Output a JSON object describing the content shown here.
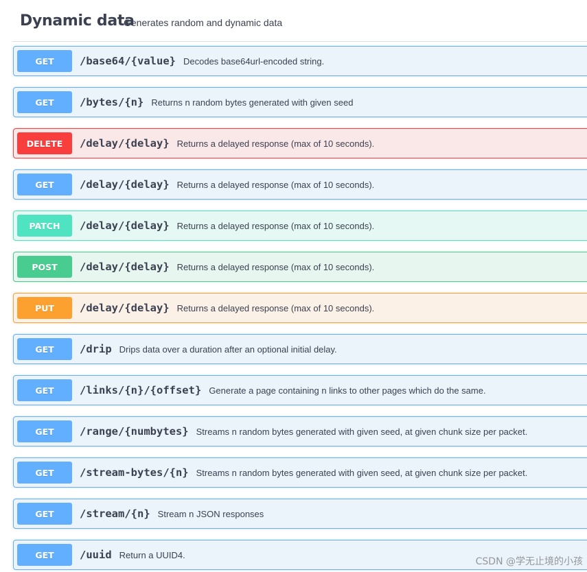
{
  "section": {
    "title": "Dynamic data",
    "description": "Generates random and dynamic data"
  },
  "operations": [
    {
      "method": "GET",
      "path": "/base64/{value}",
      "summary": "Decodes base64url-encoded string."
    },
    {
      "method": "GET",
      "path": "/bytes/{n}",
      "summary": "Returns n random bytes generated with given seed"
    },
    {
      "method": "DELETE",
      "path": "/delay/{delay}",
      "summary": "Returns a delayed response (max of 10 seconds)."
    },
    {
      "method": "GET",
      "path": "/delay/{delay}",
      "summary": "Returns a delayed response (max of 10 seconds)."
    },
    {
      "method": "PATCH",
      "path": "/delay/{delay}",
      "summary": "Returns a delayed response (max of 10 seconds)."
    },
    {
      "method": "POST",
      "path": "/delay/{delay}",
      "summary": "Returns a delayed response (max of 10 seconds)."
    },
    {
      "method": "PUT",
      "path": "/delay/{delay}",
      "summary": "Returns a delayed response (max of 10 seconds)."
    },
    {
      "method": "GET",
      "path": "/drip",
      "summary": "Drips data over a duration after an optional initial delay."
    },
    {
      "method": "GET",
      "path": "/links/{n}/{offset}",
      "summary": "Generate a page containing n links to other pages which do the same."
    },
    {
      "method": "GET",
      "path": "/range/{numbytes}",
      "summary": "Streams n random bytes generated with given seed, at given chunk size per packet."
    },
    {
      "method": "GET",
      "path": "/stream-bytes/{n}",
      "summary": "Streams n random bytes generated with given seed, at given chunk size per packet."
    },
    {
      "method": "GET",
      "path": "/stream/{n}",
      "summary": "Stream n JSON responses"
    },
    {
      "method": "GET",
      "path": "/uuid",
      "summary": "Return a UUID4."
    }
  ],
  "colors": {
    "GET": "#61affe",
    "DELETE": "#f93e3e",
    "PATCH": "#50e3c2",
    "POST": "#49cc90",
    "PUT": "#fca130"
  },
  "watermark": "CSDN @学无止境的小孩"
}
